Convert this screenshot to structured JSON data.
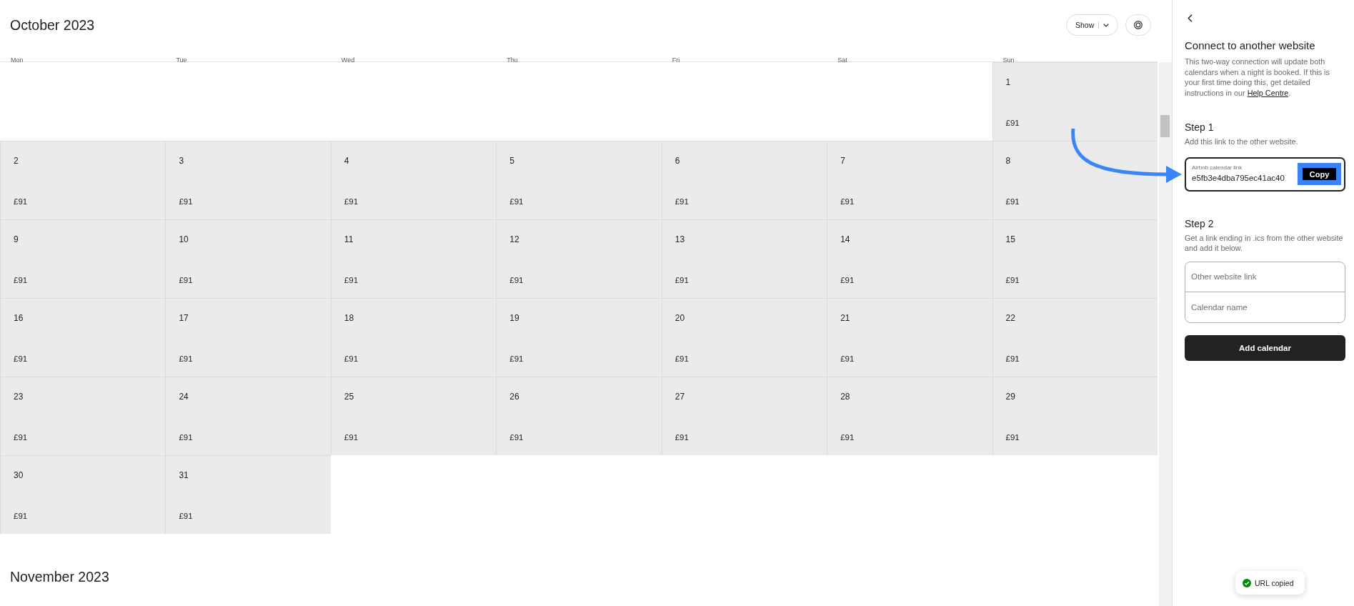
{
  "calendar": {
    "title": "October 2023",
    "show_button": "Show",
    "weekdays": [
      "Mon",
      "Tue",
      "Wed",
      "Thu",
      "Fri",
      "Sat",
      "Sun"
    ],
    "weeks": [
      [
        {
          "kind": "blank"
        },
        {
          "kind": "blank"
        },
        {
          "kind": "blank"
        },
        {
          "kind": "blank"
        },
        {
          "kind": "blank"
        },
        {
          "kind": "blank"
        },
        {
          "kind": "day",
          "day": "1",
          "price": "£91"
        }
      ],
      [
        {
          "kind": "day",
          "day": "2",
          "price": "£91"
        },
        {
          "kind": "day",
          "day": "3",
          "price": "£91"
        },
        {
          "kind": "day",
          "day": "4",
          "price": "£91"
        },
        {
          "kind": "day",
          "day": "5",
          "price": "£91"
        },
        {
          "kind": "day",
          "day": "6",
          "price": "£91"
        },
        {
          "kind": "day",
          "day": "7",
          "price": "£91"
        },
        {
          "kind": "day",
          "day": "8",
          "price": "£91"
        }
      ],
      [
        {
          "kind": "day",
          "day": "9",
          "price": "£91"
        },
        {
          "kind": "day",
          "day": "10",
          "price": "£91"
        },
        {
          "kind": "day",
          "day": "11",
          "price": "£91"
        },
        {
          "kind": "day",
          "day": "12",
          "price": "£91"
        },
        {
          "kind": "day",
          "day": "13",
          "price": "£91"
        },
        {
          "kind": "day",
          "day": "14",
          "price": "£91"
        },
        {
          "kind": "day",
          "day": "15",
          "price": "£91"
        }
      ],
      [
        {
          "kind": "day",
          "day": "16",
          "price": "£91"
        },
        {
          "kind": "day",
          "day": "17",
          "price": "£91"
        },
        {
          "kind": "day",
          "day": "18",
          "price": "£91"
        },
        {
          "kind": "day",
          "day": "19",
          "price": "£91"
        },
        {
          "kind": "day",
          "day": "20",
          "price": "£91"
        },
        {
          "kind": "day",
          "day": "21",
          "price": "£91"
        },
        {
          "kind": "day",
          "day": "22",
          "price": "£91"
        }
      ],
      [
        {
          "kind": "day",
          "day": "23",
          "price": "£91"
        },
        {
          "kind": "day",
          "day": "24",
          "price": "£91"
        },
        {
          "kind": "day",
          "day": "25",
          "price": "£91"
        },
        {
          "kind": "day",
          "day": "26",
          "price": "£91"
        },
        {
          "kind": "day",
          "day": "27",
          "price": "£91"
        },
        {
          "kind": "day",
          "day": "28",
          "price": "£91"
        },
        {
          "kind": "day",
          "day": "29",
          "price": "£91"
        }
      ],
      [
        {
          "kind": "day",
          "day": "30",
          "price": "£91"
        },
        {
          "kind": "day",
          "day": "31",
          "price": "£91"
        },
        {
          "kind": "blank"
        },
        {
          "kind": "blank"
        },
        {
          "kind": "blank"
        },
        {
          "kind": "blank"
        },
        {
          "kind": "blank"
        }
      ]
    ],
    "next_title": "November 2023"
  },
  "panel": {
    "title": "Connect to another website",
    "description": "This two-way connection will update both calendars when a night is booked. If this is your first time doing this, get detailed instructions in our",
    "help_link": "Help Centre",
    "description_end": ".",
    "step_1": {
      "title": "Step 1",
      "text": "Add this link to the other website.",
      "field_label": "Airbnb calendar link",
      "field_value": "e5fb3e4dba795ec41ac40",
      "button": "Copy"
    },
    "step_2": {
      "title": "Step 2",
      "text": "Get a link ending in .ics from the other website and add it below.",
      "fields": [
        {
          "placeholder": "Other website link"
        },
        {
          "placeholder": "Calendar name"
        }
      ],
      "button": "Add calendar"
    }
  },
  "toast": {
    "text": "URL copied"
  }
}
